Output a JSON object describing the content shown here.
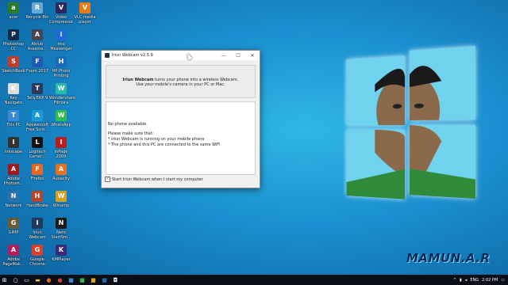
{
  "desktop_icons": [
    {
      "label": "acer",
      "icon": "acer-icon",
      "color": "#2a7a2a"
    },
    {
      "label": "Photoshop\nCC",
      "icon": "photoshop-icon",
      "color": "#0b2b4a"
    },
    {
      "label": "SketchBook",
      "icon": "sketchbook-icon",
      "color": "#c43a2a"
    },
    {
      "label": "Key\nNavigato",
      "icon": "key-icon",
      "color": "#ddd"
    },
    {
      "label": "This PC",
      "icon": "pc-icon",
      "color": "#3a8ad6"
    },
    {
      "label": "Inkscape",
      "icon": "inkscape-icon",
      "color": "#333"
    },
    {
      "label": "Adobe\nPhotosh...",
      "icon": "adobe-icon",
      "color": "#a01818"
    },
    {
      "label": "Network",
      "icon": "network-icon",
      "color": "#2d6fa8"
    },
    {
      "label": "GIMP",
      "icon": "gimp-icon",
      "color": "#6b5a3a"
    },
    {
      "label": "Adobe\nPageMak...",
      "icon": "pagemaker-icon",
      "color": "#b01e5a"
    },
    {
      "label": "Recycle Bin",
      "icon": "recycle-bin-icon",
      "color": "#6aa8d8"
    },
    {
      "label": "Akruti\nAssame...",
      "icon": "akruti-icon",
      "color": "#445"
    },
    {
      "label": "Fxem 2017",
      "icon": "fxem-icon",
      "color": "#1e5ab4"
    },
    {
      "label": "Tally.ERP 9",
      "icon": "tally-icon",
      "color": "#2b3a5a"
    },
    {
      "label": "Apowersoft\nFree Scre...",
      "icon": "apowersoft-icon",
      "color": "#1a9ad6"
    },
    {
      "label": "Logitech\nCamer...",
      "icon": "logitech-icon",
      "color": "#111"
    },
    {
      "label": "Firefox",
      "icon": "firefox-icon",
      "color": "#e8661e"
    },
    {
      "label": "HandBrake",
      "icon": "handbrake-icon",
      "color": "#b8452a"
    },
    {
      "label": "Iriun\nWebcam",
      "icon": "iriun-icon",
      "color": "#1e3a5a"
    },
    {
      "label": "Google\nChrome",
      "icon": "chrome-icon",
      "color": "#d8402a"
    },
    {
      "label": "Video\nCompressor",
      "icon": "video-compressor-icon",
      "color": "#2a2a5a"
    },
    {
      "label": "imo\nMessenger",
      "icon": "imo-icon",
      "color": "#1e6ad6"
    },
    {
      "label": "HP Photo\nPrinting",
      "icon": "hp-icon",
      "color": "#1a6ab8"
    },
    {
      "label": "Wondershare\nFilmora",
      "icon": "filmora-icon",
      "color": "#2ab8a8"
    },
    {
      "label": "WhatsApp",
      "icon": "whatsapp-icon",
      "color": "#2fbd4e"
    },
    {
      "label": "InPage 2009",
      "icon": "inpage-icon",
      "color": "#b41e1e"
    },
    {
      "label": "Audacity",
      "icon": "audacity-icon",
      "color": "#e8701e"
    },
    {
      "label": "Winamp",
      "icon": "winamp-icon",
      "color": "#d8a01e"
    },
    {
      "label": "Nero\nStartSm...",
      "icon": "nero-icon",
      "color": "#1a1a1a"
    },
    {
      "label": "KMPlayer",
      "icon": "kmplayer-icon",
      "color": "#3a2a7a"
    },
    {
      "label": "VLC media\nplayer",
      "icon": "vlc-icon",
      "color": "#ee7a10"
    }
  ],
  "window": {
    "title": "Iriun Webcam v2.5.9",
    "header_brand": "Iriun Webcam",
    "header_line1_rest": " turns your phone into a wireless Webcam.",
    "header_line2": "Use your mobile's camera in your PC or Mac.",
    "status": "No phone available.",
    "make_sure": "Please make sure that:",
    "bullet1": "* Iriun Webcam is running on your mobile phone",
    "bullet2": "* The phone and this PC are connected to the same WiFi",
    "startup_checkbox_label": "Start Iriun Webcam when I start my computer",
    "startup_checked": true,
    "minimize": "—",
    "maximize": "☐",
    "close": "✕"
  },
  "watermark": "MAMUN.A.R",
  "taskbar": {
    "start": "⊞",
    "lang": "ENG",
    "time": "2:02 PM"
  }
}
